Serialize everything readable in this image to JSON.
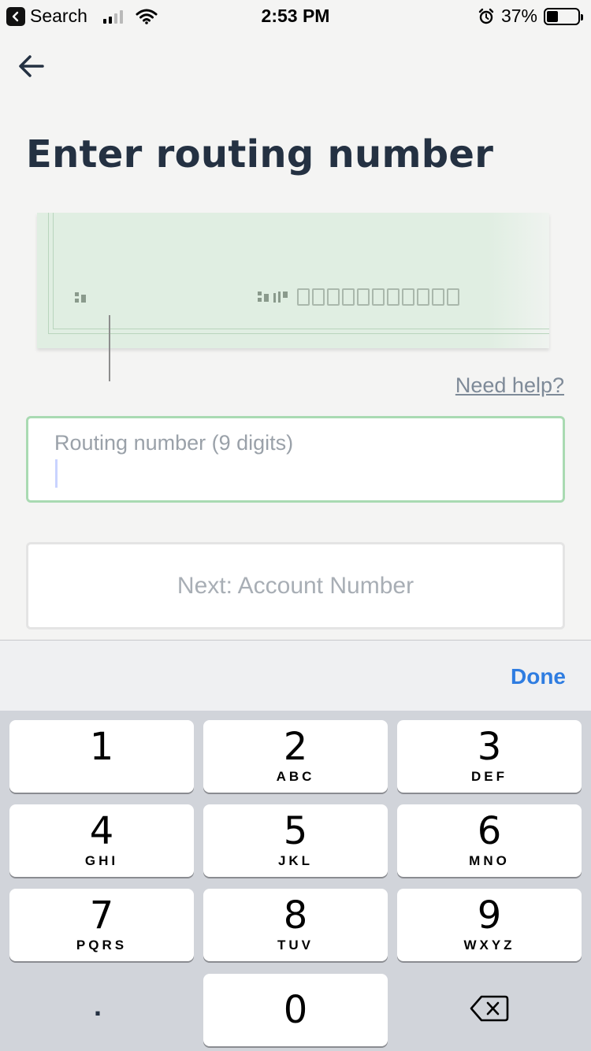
{
  "status_bar": {
    "back_app": "Search",
    "time": "2:53 PM",
    "battery": "37%",
    "battery_level": 0.37
  },
  "page": {
    "title": "Enter routing number",
    "help_link": "Need help?",
    "routing_placeholder": "Routing number (9 digits)",
    "next_button": "Next: Account Number"
  },
  "keyboard": {
    "done": "Done",
    "keys": [
      {
        "num": "1",
        "letters": ""
      },
      {
        "num": "2",
        "letters": "ABC"
      },
      {
        "num": "3",
        "letters": "DEF"
      },
      {
        "num": "4",
        "letters": "GHI"
      },
      {
        "num": "5",
        "letters": "JKL"
      },
      {
        "num": "6",
        "letters": "MNO"
      },
      {
        "num": "7",
        "letters": "PQRS"
      },
      {
        "num": "8",
        "letters": "TUV"
      },
      {
        "num": "9",
        "letters": "WXYZ"
      },
      {
        "num": "0",
        "letters": ""
      }
    ],
    "dot": "."
  },
  "colors": {
    "title": "#243142",
    "input_border": "#a9dab2",
    "done_blue": "#2f7de1",
    "check_green": "#e0eee2"
  },
  "icons": [
    "back-arrow-icon",
    "wifi-icon",
    "alarm-icon",
    "battery-icon",
    "delete-key-icon",
    "back-app-chevron-icon"
  ]
}
